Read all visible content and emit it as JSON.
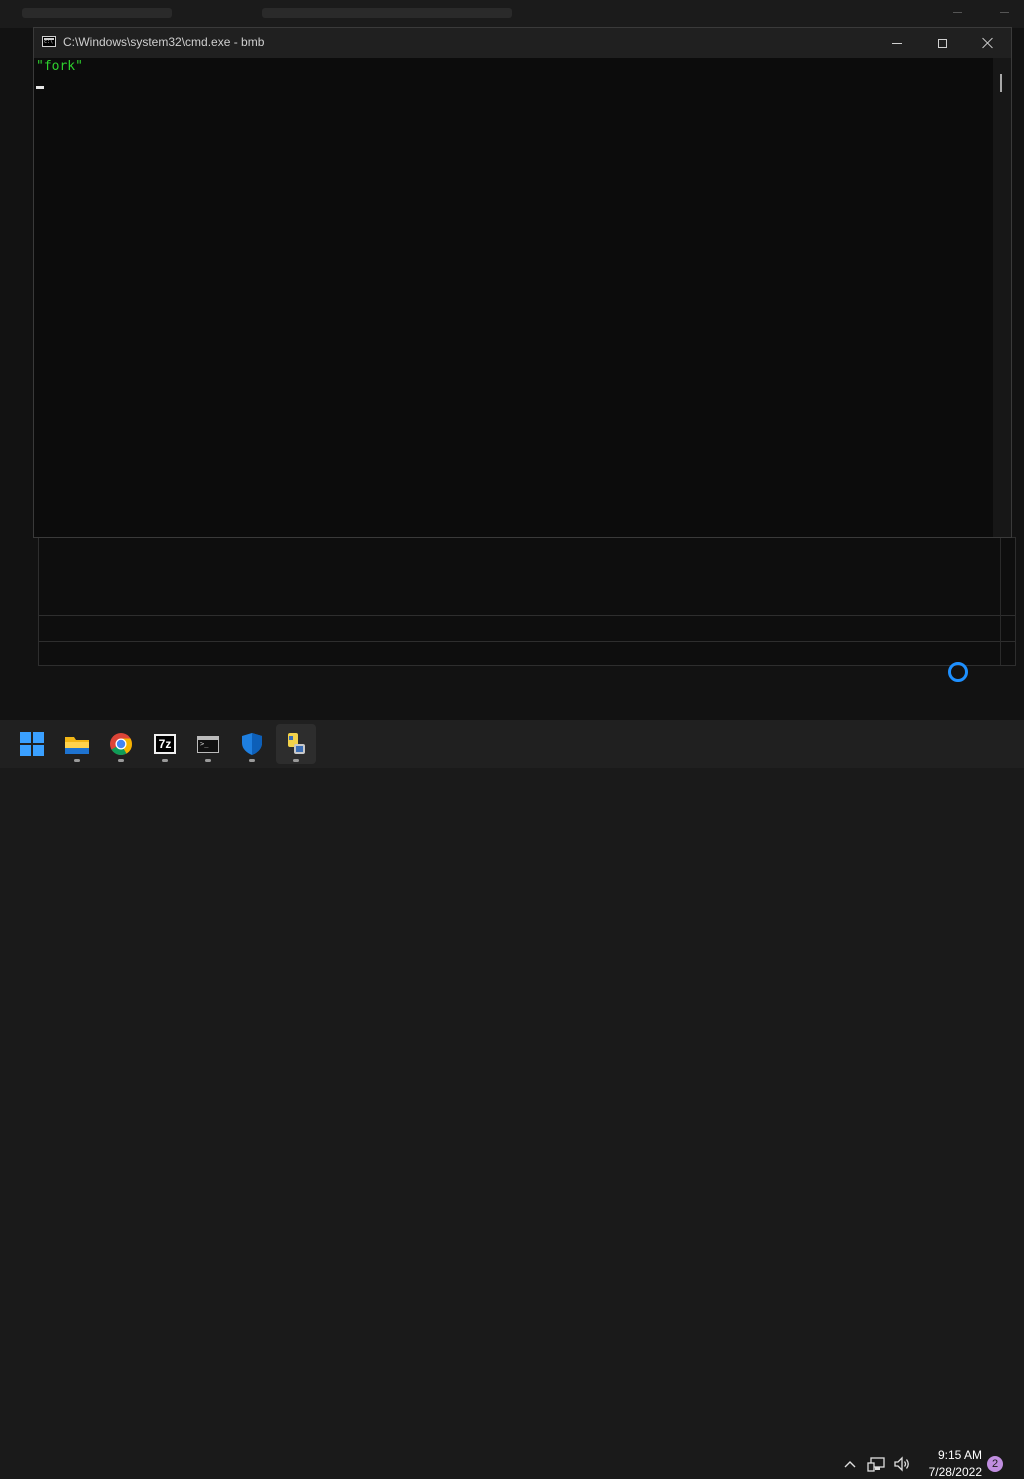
{
  "window": {
    "title": "C:\\Windows\\system32\\cmd.exe - bmb",
    "controls": [
      "minimize",
      "maximize",
      "close"
    ]
  },
  "console": {
    "lines": [
      "\"fork\""
    ],
    "text_color": "#2ed12e"
  },
  "taskbar": {
    "apps": [
      {
        "name": "start",
        "icon": "windows-logo-icon"
      },
      {
        "name": "file-explorer",
        "icon": "folder-icon"
      },
      {
        "name": "chrome",
        "icon": "chrome-icon"
      },
      {
        "name": "7-zip",
        "icon": "sevenzip-icon",
        "label": "7z"
      },
      {
        "name": "command-prompt",
        "icon": "terminal-icon"
      },
      {
        "name": "windows-security",
        "icon": "shield-icon"
      },
      {
        "name": "python",
        "icon": "python-icon"
      }
    ],
    "tray": {
      "time": "9:15 AM",
      "date": "7/28/2022",
      "notifications": "2"
    }
  },
  "colors": {
    "accent": "#3aa0ff",
    "spinner": "#1e90ff",
    "badge": "#c08ee0"
  }
}
